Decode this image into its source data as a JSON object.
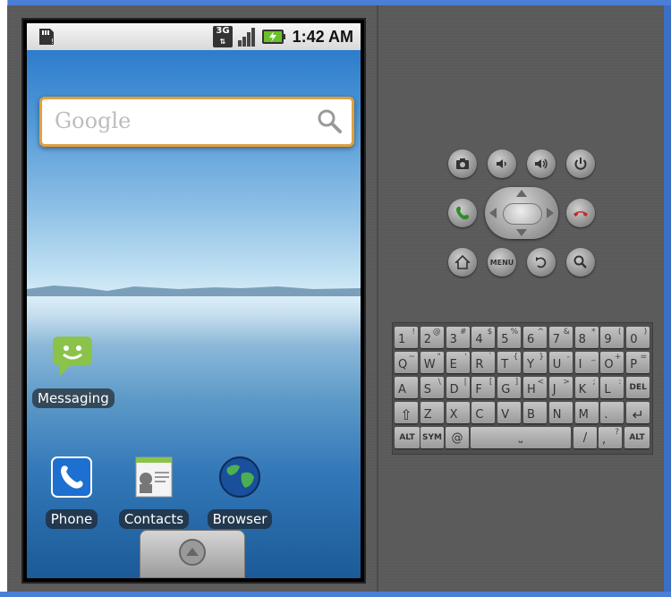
{
  "status_bar": {
    "network": "3G",
    "time": "1:42 AM"
  },
  "search": {
    "placeholder": "Google"
  },
  "apps": {
    "messaging": "Messaging",
    "phone": "Phone",
    "contacts": "Contacts",
    "browser": "Browser"
  },
  "controls": {
    "menu": "MENU"
  },
  "keyboard": {
    "row1": [
      {
        "main": "1",
        "sub": "!"
      },
      {
        "main": "2",
        "sub": "@"
      },
      {
        "main": "3",
        "sub": "#"
      },
      {
        "main": "4",
        "sub": "$"
      },
      {
        "main": "5",
        "sub": "%"
      },
      {
        "main": "6",
        "sub": "^"
      },
      {
        "main": "7",
        "sub": "&"
      },
      {
        "main": "8",
        "sub": "*"
      },
      {
        "main": "9",
        "sub": "("
      },
      {
        "main": "0",
        "sub": ")"
      }
    ],
    "row2": [
      {
        "main": "Q",
        "sub": "~"
      },
      {
        "main": "W",
        "sub": "\""
      },
      {
        "main": "E",
        "sub": "'"
      },
      {
        "main": "R",
        "sub": "`"
      },
      {
        "main": "T",
        "sub": "{"
      },
      {
        "main": "Y",
        "sub": "}"
      },
      {
        "main": "U",
        "sub": "-"
      },
      {
        "main": "I",
        "sub": "_"
      },
      {
        "main": "O",
        "sub": "+"
      },
      {
        "main": "P",
        "sub": "="
      }
    ],
    "row3": [
      {
        "main": "A",
        "sub": ""
      },
      {
        "main": "S",
        "sub": "\\"
      },
      {
        "main": "D",
        "sub": "|"
      },
      {
        "main": "F",
        "sub": "["
      },
      {
        "main": "G",
        "sub": "]"
      },
      {
        "main": "H",
        "sub": "<"
      },
      {
        "main": "J",
        "sub": ">"
      },
      {
        "main": "K",
        "sub": ";"
      },
      {
        "main": "L",
        "sub": ":"
      },
      {
        "main": "DEL",
        "sub": ""
      }
    ],
    "row4": [
      {
        "main": "⇧",
        "sub": ""
      },
      {
        "main": "Z",
        "sub": ""
      },
      {
        "main": "X",
        "sub": ""
      },
      {
        "main": "C",
        "sub": ""
      },
      {
        "main": "V",
        "sub": ""
      },
      {
        "main": "B",
        "sub": ""
      },
      {
        "main": "N",
        "sub": ""
      },
      {
        "main": "M",
        "sub": ""
      },
      {
        "main": ".",
        "sub": ""
      },
      {
        "main": "↵",
        "sub": ""
      }
    ],
    "row5": {
      "alt_left": "ALT",
      "sym": "SYM",
      "at": "@",
      "slash": "/",
      "question": "?",
      "comma": ",",
      "alt_right": "ALT"
    }
  }
}
